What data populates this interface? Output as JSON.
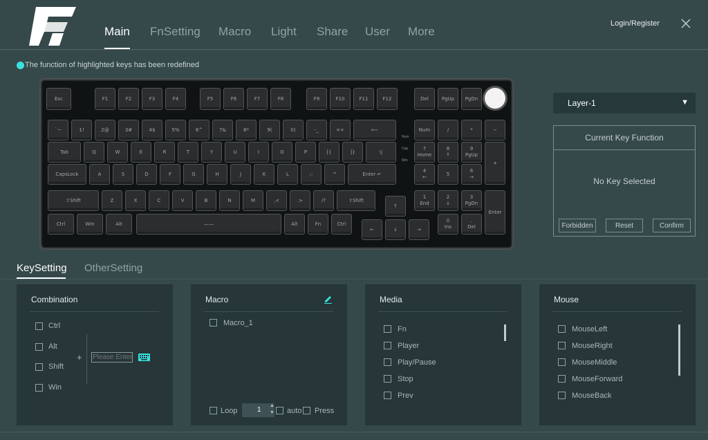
{
  "header": {
    "tabs": [
      {
        "label": "Main",
        "active": true
      },
      {
        "label": "FnSetting",
        "active": false
      },
      {
        "label": "Macro",
        "active": false
      },
      {
        "label": "Light",
        "active": false
      },
      {
        "label": "Share",
        "active": false
      },
      {
        "label": "User",
        "active": false
      },
      {
        "label": "More",
        "active": false
      }
    ],
    "login_label": "Login/Register",
    "close_icon": "close-icon"
  },
  "notice": "The function of highlighted keys has been redefined",
  "keyboard": {
    "keys": [
      "Esc",
      "F1",
      "F2",
      "F3",
      "F4",
      "F5",
      "F6",
      "F7",
      "F8",
      "F9",
      "F10",
      "F11",
      "F12",
      "Del",
      "PgUp",
      "PgDn",
      "`~",
      "1!",
      "2@",
      "3#",
      "4$",
      "5%",
      "6^",
      "7&",
      "8*",
      "9(",
      "0)",
      "-_",
      "=+",
      "⟵",
      "Num",
      "/",
      "*",
      "−",
      "Tab",
      "Q",
      "W",
      "E",
      "R",
      "T",
      "Y",
      "U",
      "I",
      "O",
      "P",
      "[{",
      "]}",
      "\\|",
      "7\nHome",
      "8\n↑",
      "9\nPgUp",
      "+",
      "CapsLock",
      "A",
      "S",
      "D",
      "F",
      "G",
      "H",
      "J",
      "K",
      "L",
      ";:",
      "'\"",
      "Enter ↵",
      "4\n←",
      "5",
      "6\n→",
      "⇧Shift",
      "Z",
      "X",
      "C",
      "V",
      "B",
      "N",
      "M",
      ",<",
      ".>",
      "/?",
      "⇧Shift",
      "↑",
      "1\nEnd",
      "2\n↓",
      "3\nPgDn",
      "Enter",
      "Ctrl",
      "Win",
      "Alt",
      "——",
      "Alt",
      "Fn",
      "Ctrl",
      "←",
      "↓",
      "→",
      "0\nIns",
      ".\nDel"
    ],
    "indicators": [
      "Num",
      "Cap",
      "Win"
    ]
  },
  "layer": {
    "selected": "Layer-1"
  },
  "current_key": {
    "title": "Current Key Function",
    "empty": "No Key Selected",
    "buttons": [
      "Forbidden",
      "Reset",
      "Confirm"
    ]
  },
  "subtabs": [
    {
      "label": "KeySetting",
      "active": true
    },
    {
      "label": "OtherSetting",
      "active": false
    }
  ],
  "combination": {
    "title": "Combination",
    "mods": [
      "Ctrl",
      "Alt",
      "Shift",
      "Win"
    ],
    "plus": "+",
    "input_placeholder": "Please Enter"
  },
  "macro": {
    "title": "Macro",
    "items": [
      "Macro_1"
    ],
    "loop_label": "Loop",
    "loop_value": "1",
    "auto_label": "auto",
    "press_label": "Press"
  },
  "media": {
    "title": "Media",
    "items": [
      "Fn",
      "Player",
      "Play/Pause",
      "Stop",
      "Prev"
    ]
  },
  "mouse": {
    "title": "Mouse",
    "items": [
      "MouseLeft",
      "MouseRight",
      "MouseMiddle",
      "MouseForward",
      "MouseBack"
    ]
  },
  "colors": {
    "accent": "#39e1e1",
    "background": "#35484a",
    "panel": "#263639"
  }
}
